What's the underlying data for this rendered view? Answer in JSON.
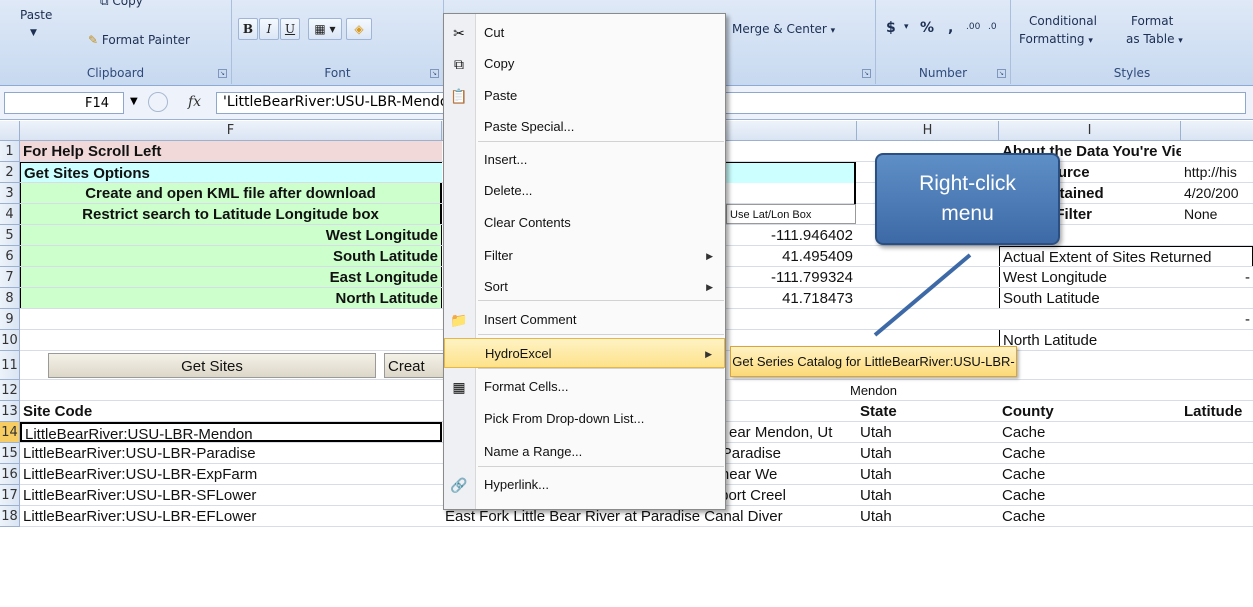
{
  "ribbon": {
    "paste_label": "Paste",
    "copy_label": "Copy",
    "format_painter_label": "Format Painter",
    "clipboard_group": "Clipboard",
    "font_group": "Font",
    "bold": "B",
    "italic": "I",
    "underline": "U",
    "merge_center": "Merge & Center",
    "number_group": "Number",
    "currency": "$",
    "percent": "%",
    "comma": ",",
    "inc_decimal": ".00",
    "dec_decimal": ".0",
    "conditional_formatting": "Conditional",
    "conditional_formatting_2": "Formatting",
    "format_as_table": "Format",
    "format_as_table_2": "as Table",
    "styles_group": "Styles"
  },
  "formula_bar": {
    "cell_ref": "F14",
    "fx": "fx",
    "content": "'LittleBearRiver:USU-LBR-Mendon"
  },
  "columns": [
    "F",
    "H",
    "I"
  ],
  "rows": [
    {
      "n": "1",
      "f": "For Help Scroll Left",
      "h": "",
      "i": "About the Data You're Viewing",
      "j": ""
    },
    {
      "n": "2",
      "f": "Get Sites Options",
      "h": "",
      "i": "Data Source",
      "j": "http://his"
    },
    {
      "n": "3",
      "f": "Create and open KML file after download",
      "h": "",
      "i": "Date Obtained",
      "j": "4/20/200"
    },
    {
      "n": "4",
      "f": "Restrict search to Latitude Longitude box",
      "g": "Use Lat/Lon Box",
      "h": "",
      "i": "Spatial Filter",
      "j": "None"
    },
    {
      "n": "5",
      "f": "West Longitude",
      "g": "-111.946402",
      "h": "",
      "i": "",
      "j": ""
    },
    {
      "n": "6",
      "f": "South Latitude",
      "g": "41.495409",
      "h": "",
      "i": "Actual Extent of Sites Returned",
      "j": ""
    },
    {
      "n": "7",
      "f": "East Longitude",
      "g": "-111.799324",
      "h": "",
      "i": "West Longitude",
      "j": "-"
    },
    {
      "n": "8",
      "f": "North Latitude",
      "g": "41.718473",
      "h": "",
      "i": "South Latitude",
      "j": ""
    },
    {
      "n": "9",
      "f": "",
      "h": "",
      "i": "",
      "j": "-"
    },
    {
      "n": "10",
      "f": "",
      "h": "",
      "i": "North Latitude",
      "j": ""
    },
    {
      "n": "11",
      "f": "Get Sites",
      "h": "",
      "i": "",
      "j": ""
    },
    {
      "n": "12",
      "f": "",
      "h": "",
      "i": "",
      "j": ""
    },
    {
      "n": "13",
      "f": "Site Code",
      "h": "State",
      "i": "County",
      "j": "Latitude"
    },
    {
      "n": "14",
      "f": "LittleBearRiver:USU-LBR-Mendon",
      "g": "ear Mendon, Ut",
      "h": "Utah",
      "i": "Cache",
      "j": ""
    },
    {
      "n": "15",
      "f": "LittleBearRiver:USU-LBR-Paradise",
      "g": "Little Bear River at McMurdy Hollow near Paradise",
      "h": "Utah",
      "i": "Cache",
      "j": ""
    },
    {
      "n": "16",
      "f": "LittleBearRiver:USU-LBR-ExpFarm",
      "g": "Utah State University Experimental Farm near We",
      "h": "Utah",
      "i": "Cache",
      "j": ""
    },
    {
      "n": "17",
      "f": "LittleBearRiver:USU-LBR-SFLower",
      "g": "South Fork Little Bear River below Davenport Creel",
      "h": "Utah",
      "i": "Cache",
      "j": ""
    },
    {
      "n": "18",
      "f": "LittleBearRiver:USU-LBR-EFLower",
      "g": "East Fork Little Bear River at Paradise Canal Diver",
      "h": "Utah",
      "i": "Cache",
      "j": ""
    }
  ],
  "create_button_label": "Creat",
  "context_menu": {
    "items": [
      "Cut",
      "Copy",
      "Paste",
      "Paste Special...",
      "Insert...",
      "Delete...",
      "Clear Contents",
      "Filter",
      "Sort",
      "Insert Comment",
      "HydroExcel",
      "Format Cells...",
      "Pick From Drop-down List...",
      "Name a Range...",
      "Hyperlink..."
    ],
    "submenu_item": "Get Series Catalog for LittleBearRiver:USU-LBR-Mendon"
  },
  "callout": {
    "line1": "Right-click",
    "line2": "menu"
  },
  "colors": {
    "help_row": "#f2d9d9",
    "options_row": "#ccffff",
    "green": "#ccffcc",
    "highlight": "#fde28a",
    "callout": "#4f7fbf"
  }
}
